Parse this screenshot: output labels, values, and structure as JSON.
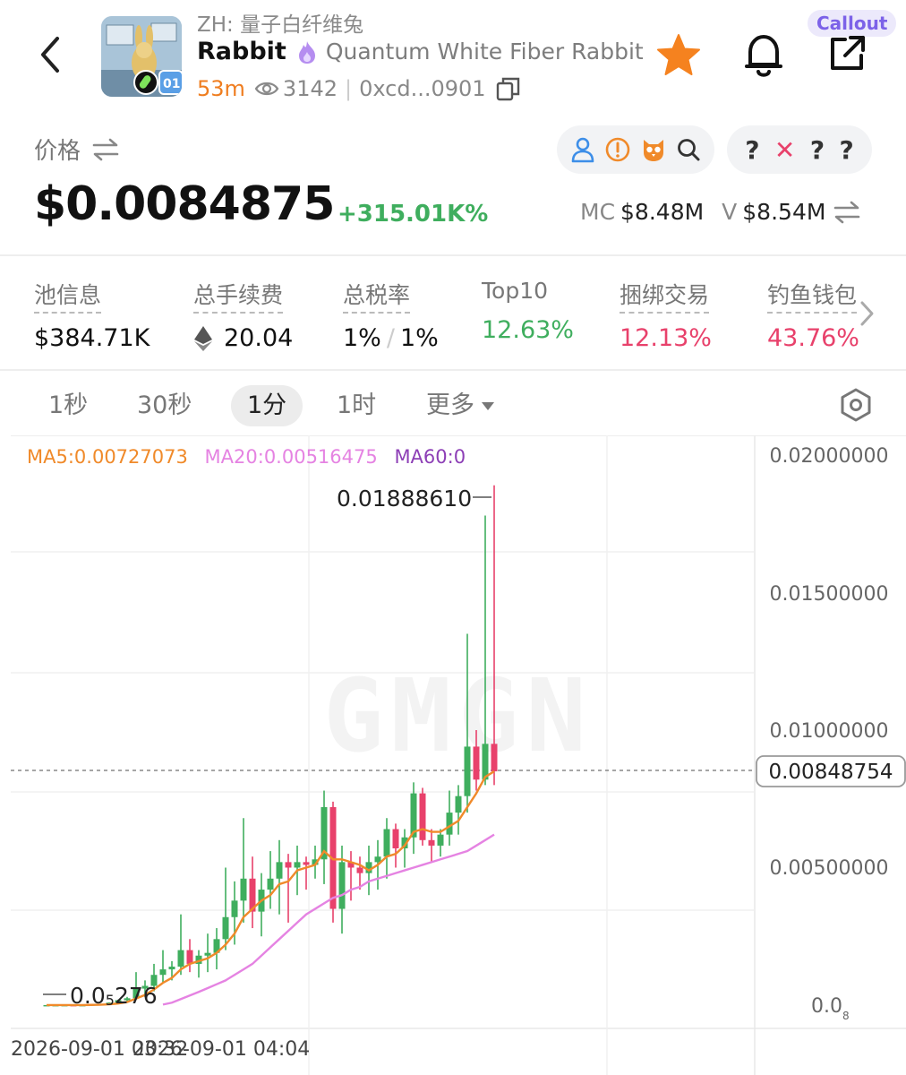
{
  "header": {
    "back_icon": "chevron-left-icon",
    "zh_name": "ZH: 量子白纤维兔",
    "symbol": "Rabbit",
    "full_name": "Quantum White Fiber Rabbit",
    "age": "53m",
    "views": "3142",
    "address": "0xcd...0901",
    "callout_label": "Callout",
    "star_color": "#f5821f"
  },
  "price": {
    "label": "价格",
    "value": "$0.0084875",
    "change": "+315.01K%",
    "mc_label": "MC",
    "mc_value": "$8.48M",
    "v_label": "V",
    "v_value": "$8.54M",
    "pill_b_marks": [
      "?",
      "✕",
      "?",
      "?"
    ]
  },
  "stats": [
    {
      "label": "池信息",
      "value": "$384.71K"
    },
    {
      "label": "总手续费",
      "value": "20.04"
    },
    {
      "label": "总税率",
      "value": "1%",
      "value2": "1%"
    },
    {
      "label": "Top10",
      "value": "12.63%"
    },
    {
      "label": "捆绑交易",
      "value": "12.13%"
    },
    {
      "label": "钓鱼钱包",
      "value": "43.76%"
    }
  ],
  "timeframes": [
    "1秒",
    "30秒",
    "1分",
    "1时",
    "更多"
  ],
  "active_timeframe": "1分",
  "chart": {
    "ma5": "MA5:0.00727073",
    "ma20": "MA20:0.00516475",
    "ma60": "MA60:0",
    "high_label": "0.01888610",
    "low_label_main": "0.0",
    "low_label_sub": "5",
    "low_label_tail": "276",
    "current_price_label": "0.00848754",
    "y_tick_labels": [
      "0.02000000",
      "0.01500000",
      "0.01000000",
      "0.00500000"
    ],
    "zero_label_main": "0.0",
    "zero_label_sub": "8",
    "date_label_1": "2026-09-01 03:32",
    "date_label_2": "2026-09-01 04:04",
    "watermark": "GMGN",
    "up_color": "#3fae5e",
    "down_color": "#e8416b",
    "ma5_color": "#f08a2a",
    "ma20_color": "#e583e2"
  },
  "chart_data": {
    "type": "candlestick",
    "y_range": [
      0,
      0.02
    ],
    "y_ticks": [
      0.02,
      0.015,
      0.01,
      0.005,
      0
    ],
    "current_price": 0.00848754,
    "series": [
      {
        "name": "candles",
        "ohlc": [
          [
            3e-06,
            3e-06,
            3e-06,
            3e-06
          ],
          [
            3e-06,
            4e-06,
            2e-06,
            3e-06
          ],
          [
            3e-06,
            4e-06,
            3e-06,
            4e-06
          ],
          [
            4e-06,
            4e-06,
            3e-06,
            3e-06
          ],
          [
            3e-06,
            5e-06,
            3e-06,
            4e-06
          ],
          [
            4e-06,
            3e-05,
            4e-06,
            3e-05
          ],
          [
            3e-05,
            5e-05,
            2e-05,
            4e-05
          ],
          [
            4e-05,
            0.0001,
            3e-05,
            9e-05
          ],
          [
            9e-05,
            0.0002,
            8e-05,
            0.00018
          ],
          [
            0.00018,
            0.0003,
            0.00015,
            0.00025
          ],
          [
            0.00025,
            0.0012,
            0.0002,
            0.0006
          ],
          [
            0.0006,
            0.0009,
            0.0003,
            0.0007
          ],
          [
            0.0007,
            0.0015,
            0.0005,
            0.0011
          ],
          [
            0.0011,
            0.002,
            0.0008,
            0.0013
          ],
          [
            0.0013,
            0.0016,
            0.0009,
            0.0014
          ],
          [
            0.0014,
            0.0033,
            0.0011,
            0.002
          ],
          [
            0.002,
            0.0024,
            0.0012,
            0.0015
          ],
          [
            0.0015,
            0.002,
            0.001,
            0.0018
          ],
          [
            0.0018,
            0.0026,
            0.0012,
            0.0019
          ],
          [
            0.0019,
            0.0028,
            0.0013,
            0.0024
          ],
          [
            0.0024,
            0.005,
            0.002,
            0.0032
          ],
          [
            0.0032,
            0.0045,
            0.0022,
            0.0038
          ],
          [
            0.0038,
            0.0068,
            0.003,
            0.0046
          ],
          [
            0.0046,
            0.0054,
            0.0028,
            0.0034
          ],
          [
            0.0034,
            0.0048,
            0.0025,
            0.0042
          ],
          [
            0.0042,
            0.0056,
            0.0035,
            0.0046
          ],
          [
            0.0046,
            0.006,
            0.0033,
            0.0052
          ],
          [
            0.0052,
            0.0055,
            0.003,
            0.005
          ],
          [
            0.005,
            0.0058,
            0.004,
            0.0052
          ],
          [
            0.0052,
            0.0054,
            0.0042,
            0.0051
          ],
          [
            0.0051,
            0.0058,
            0.0046,
            0.0053
          ],
          [
            0.0053,
            0.0078,
            0.0044,
            0.0072
          ],
          [
            0.0072,
            0.0074,
            0.003,
            0.0035
          ],
          [
            0.0035,
            0.0058,
            0.0026,
            0.0052
          ],
          [
            0.0052,
            0.0056,
            0.0038,
            0.005
          ],
          [
            0.005,
            0.0054,
            0.0042,
            0.0048
          ],
          [
            0.0048,
            0.0058,
            0.004,
            0.0052
          ],
          [
            0.0052,
            0.006,
            0.0042,
            0.0054
          ],
          [
            0.0054,
            0.0068,
            0.0046,
            0.0064
          ],
          [
            0.0064,
            0.0066,
            0.005,
            0.0057
          ],
          [
            0.0057,
            0.0064,
            0.005,
            0.0061
          ],
          [
            0.0061,
            0.0081,
            0.0055,
            0.0077
          ],
          [
            0.0077,
            0.0079,
            0.0058,
            0.006
          ],
          [
            0.006,
            0.0064,
            0.0052,
            0.0058
          ],
          [
            0.0058,
            0.0064,
            0.0054,
            0.0062
          ],
          [
            0.0062,
            0.0078,
            0.0058,
            0.007
          ],
          [
            0.007,
            0.008,
            0.0062,
            0.0076
          ],
          [
            0.0076,
            0.0135,
            0.007,
            0.0094
          ],
          [
            0.0094,
            0.01,
            0.0078,
            0.0082
          ],
          [
            0.0082,
            0.0178,
            0.008,
            0.0095
          ],
          [
            0.0095,
            0.0189,
            0.008,
            0.0085
          ]
        ]
      },
      {
        "name": "MA5",
        "values": [
          3e-06,
          3e-06,
          3e-06,
          3e-06,
          3e-06,
          8e-06,
          1.5e-05,
          3e-05,
          6e-05,
          0.00011,
          0.00024,
          0.00037,
          0.00057,
          0.00081,
          0.00099,
          0.0013,
          0.0015,
          0.0016,
          0.0017,
          0.0019,
          0.0022,
          0.0026,
          0.0032,
          0.0035,
          0.0038,
          0.004,
          0.0044,
          0.0045,
          0.0049,
          0.005,
          0.0051,
          0.0056,
          0.0053,
          0.0053,
          0.0052,
          0.0051,
          0.0049,
          0.0051,
          0.0054,
          0.0055,
          0.0058,
          0.0063,
          0.0064,
          0.0063,
          0.0063,
          0.0065,
          0.0067,
          0.0072,
          0.0077,
          0.0083,
          0.0085
        ]
      },
      {
        "name": "MA20",
        "values": [
          2e-05,
          9e-05,
          0.00022,
          0.00035,
          0.00048,
          0.00062,
          0.00076,
          0.0009,
          0.0011,
          0.0013,
          0.0015,
          0.0018,
          0.0021,
          0.0024,
          0.0027,
          0.003,
          0.0033,
          0.0035,
          0.0037,
          0.0039,
          0.004,
          0.0042,
          0.0043,
          0.0045,
          0.0046,
          0.0047,
          0.0048,
          0.0049,
          0.005,
          0.0051,
          0.0052,
          0.0053,
          0.0054,
          0.0055,
          0.0056,
          0.0058,
          0.006,
          0.0062
        ]
      }
    ]
  }
}
